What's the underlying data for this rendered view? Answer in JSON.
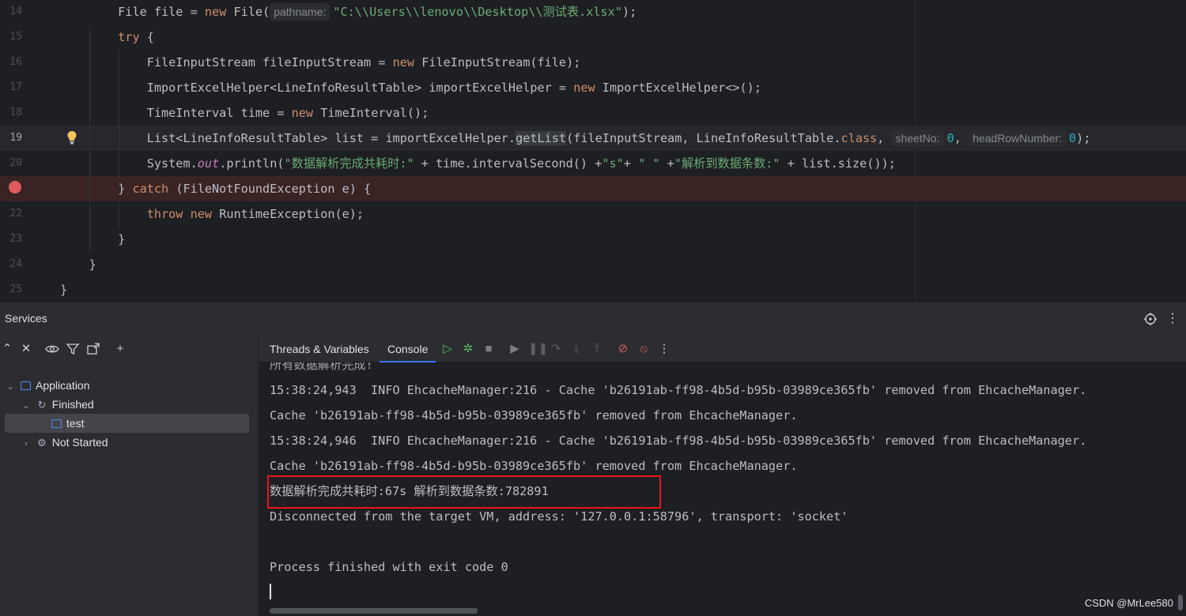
{
  "editor": {
    "lines": [
      {
        "num": "14",
        "indent": "        ",
        "parts": [
          [
            "t",
            "File file = "
          ],
          [
            "kw",
            "new"
          ],
          [
            "t",
            " File("
          ],
          [
            "hint",
            "pathname:"
          ],
          [
            "str",
            "\"C:\\\\Users\\\\lenovo\\\\Desktop\\\\测试表.xlsx\""
          ],
          [
            "t",
            ");"
          ]
        ]
      },
      {
        "num": "15",
        "indent": "        ",
        "parts": [
          [
            "kw",
            "try"
          ],
          [
            "t",
            " {"
          ]
        ]
      },
      {
        "num": "16",
        "indent": "            ",
        "parts": [
          [
            "t",
            "FileInputStream fileInputStream = "
          ],
          [
            "kw",
            "new"
          ],
          [
            "t",
            " FileInputStream(file);"
          ]
        ]
      },
      {
        "num": "17",
        "indent": "            ",
        "parts": [
          [
            "t",
            "ImportExcelHelper<LineInfoResultTable> importExcelHelper = "
          ],
          [
            "kw",
            "new"
          ],
          [
            "t",
            " ImportExcelHelper<>();"
          ]
        ]
      },
      {
        "num": "18",
        "indent": "            ",
        "parts": [
          [
            "t",
            "TimeInterval time = "
          ],
          [
            "kw",
            "new"
          ],
          [
            "t",
            " TimeInterval();"
          ]
        ]
      },
      {
        "num": "19",
        "indent": "            ",
        "parts": [
          [
            "t",
            "List<LineInfoResultTable> list = importExcelHelper."
          ],
          [
            "hl",
            "getList"
          ],
          [
            "t",
            "(fileInputStream, LineInfoResultTable."
          ],
          [
            "kw",
            "class"
          ],
          [
            "t",
            ", "
          ],
          [
            "hint",
            "sheetNo:"
          ],
          [
            "num",
            "0"
          ],
          [
            "t",
            ", "
          ],
          [
            "hint",
            "headRowNumber:"
          ],
          [
            "num",
            "0"
          ],
          [
            "t",
            ");"
          ]
        ]
      },
      {
        "num": "20",
        "indent": "            ",
        "parts": [
          [
            "t",
            "System."
          ],
          [
            "field",
            "out"
          ],
          [
            "t",
            ".println("
          ],
          [
            "str",
            "\"数据解析完成共耗时:\""
          ],
          [
            "t",
            " + time.intervalSecond() +"
          ],
          [
            "str",
            "\"s\""
          ],
          [
            "t",
            "+ "
          ],
          [
            "str",
            "\" \""
          ],
          [
            "t",
            " +"
          ],
          [
            "str",
            "\"解析到数据条数:\""
          ],
          [
            "t",
            " + list.size());"
          ]
        ]
      },
      {
        "num": "",
        "indent": "        ",
        "parts": [
          [
            "t",
            "} "
          ],
          [
            "kw",
            "catch"
          ],
          [
            "t",
            " (FileNotFoundException e) {"
          ]
        ]
      },
      {
        "num": "22",
        "indent": "            ",
        "parts": [
          [
            "kw",
            "throw"
          ],
          [
            "t",
            " "
          ],
          [
            "kw",
            "new"
          ],
          [
            "t",
            " RuntimeException(e);"
          ]
        ]
      },
      {
        "num": "23",
        "indent": "        ",
        "parts": [
          [
            "t",
            "}"
          ]
        ]
      },
      {
        "num": "24",
        "indent": "    ",
        "parts": [
          [
            "t",
            "}"
          ]
        ]
      },
      {
        "num": "25",
        "indent": "",
        "parts": [
          [
            "t",
            "}"
          ]
        ]
      }
    ],
    "current_line": "19",
    "breakpoint_line_index": 7
  },
  "services": {
    "title": "Services",
    "tree": {
      "application": "Application",
      "finished": "Finished",
      "test": "test",
      "not_started": "Not Started"
    },
    "tabs": {
      "threads": "Threads & Variables",
      "console": "Console"
    },
    "console_lines": [
      "所有数据解析完成!",
      "15:38:24,943  INFO EhcacheManager:216 - Cache 'b26191ab-ff98-4b5d-b95b-03989ce365fb' removed from EhcacheManager.",
      "Cache 'b26191ab-ff98-4b5d-b95b-03989ce365fb' removed from EhcacheManager.",
      "15:38:24,946  INFO EhcacheManager:216 - Cache 'b26191ab-ff98-4b5d-b95b-03989ce365fb' removed from EhcacheManager.",
      "Cache 'b26191ab-ff98-4b5d-b95b-03989ce365fb' removed from EhcacheManager.",
      "数据解析完成共耗时:67s 解析到数据条数:782891",
      "Disconnected from the target VM, address: '127.0.0.1:58796', transport: 'socket'",
      "",
      "Process finished with exit code 0"
    ]
  },
  "watermark": "CSDN @MrLee580",
  "colors": {
    "keyword": "#cf8e6d",
    "string": "#6aab73",
    "number": "#2aacb8",
    "breakpoint": "#db5c5c",
    "highlight_box": "#e5161d",
    "accent": "#3574f0"
  }
}
